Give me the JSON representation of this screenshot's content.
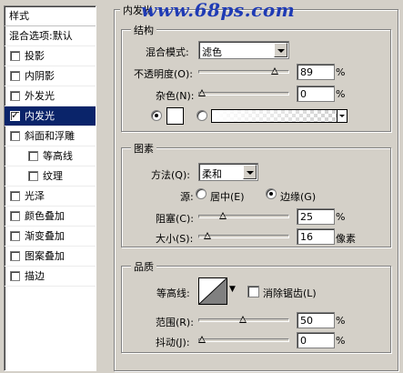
{
  "watermark": "www.68ps.com",
  "styles_panel": {
    "header": "样式",
    "items": [
      {
        "label": "混合选项:默认",
        "checkbox": false,
        "checked": false,
        "level": 0,
        "active": false
      },
      {
        "label": "投影",
        "checkbox": true,
        "checked": false,
        "level": 0,
        "active": false
      },
      {
        "label": "内阴影",
        "checkbox": true,
        "checked": false,
        "level": 0,
        "active": false
      },
      {
        "label": "外发光",
        "checkbox": true,
        "checked": false,
        "level": 0,
        "active": false
      },
      {
        "label": "内发光",
        "checkbox": true,
        "checked": true,
        "level": 0,
        "active": true
      },
      {
        "label": "斜面和浮雕",
        "checkbox": true,
        "checked": false,
        "level": 0,
        "active": false
      },
      {
        "label": "等高线",
        "checkbox": true,
        "checked": false,
        "level": 1,
        "active": false
      },
      {
        "label": "纹理",
        "checkbox": true,
        "checked": false,
        "level": 1,
        "active": false
      },
      {
        "label": "光泽",
        "checkbox": true,
        "checked": false,
        "level": 0,
        "active": false
      },
      {
        "label": "颜色叠加",
        "checkbox": true,
        "checked": false,
        "level": 0,
        "active": false
      },
      {
        "label": "渐变叠加",
        "checkbox": true,
        "checked": false,
        "level": 0,
        "active": false
      },
      {
        "label": "图案叠加",
        "checkbox": true,
        "checked": false,
        "level": 0,
        "active": false
      },
      {
        "label": "描边",
        "checkbox": true,
        "checked": false,
        "level": 0,
        "active": false
      }
    ]
  },
  "inner_glow": {
    "title": "内发光",
    "structure": {
      "legend": "结构",
      "blend_mode_label": "混合模式:",
      "blend_mode_value": "滤色",
      "opacity_label": "不透明度(O):",
      "opacity_value": "89",
      "opacity_fraction": 0.89,
      "opacity_unit": "%",
      "noise_label": "杂色(N):",
      "noise_value": "0",
      "noise_fraction": 0.0,
      "noise_unit": "%",
      "color_swatch": "#ffffff"
    },
    "elements": {
      "legend": "图素",
      "technique_label": "方法(Q):",
      "technique_value": "柔和",
      "source_label": "源:",
      "source_center": "居中(E)",
      "source_edge": "边缘(G)",
      "source_selected": "edge",
      "choke_label": "阻塞(C):",
      "choke_value": "25",
      "choke_fraction": 0.25,
      "choke_unit": "%",
      "size_label": "大小(S):",
      "size_value": "16",
      "size_fraction": 0.064,
      "size_unit": "像素"
    },
    "quality": {
      "legend": "品质",
      "contour_label": "等高线:",
      "antialias_label": "消除锯齿(L)",
      "antialias_checked": false,
      "range_label": "范围(R):",
      "range_value": "50",
      "range_fraction": 0.5,
      "range_unit": "%",
      "jitter_label": "抖动(J):",
      "jitter_value": "0",
      "jitter_fraction": 0.0,
      "jitter_unit": "%"
    }
  }
}
